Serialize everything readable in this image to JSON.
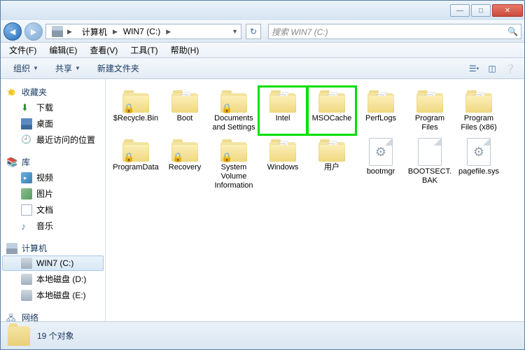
{
  "breadcrumb": {
    "seg1": "计算机",
    "seg2": "WIN7 (C:)"
  },
  "search": {
    "placeholder": "搜索 WIN7 (C:)"
  },
  "menu": {
    "file": "文件(F)",
    "edit": "编辑(E)",
    "view": "查看(V)",
    "tools": "工具(T)",
    "help": "帮助(H)"
  },
  "toolbar": {
    "organize": "组织",
    "share": "共享",
    "newfolder": "新建文件夹"
  },
  "sidebar": {
    "fav": "收藏夹",
    "download": "下载",
    "desktop": "桌面",
    "recent": "最近访问的位置",
    "lib": "库",
    "video": "视频",
    "pic": "图片",
    "doc": "文档",
    "music": "音乐",
    "computer": "计算机",
    "drive_c": "WIN7 (C:)",
    "drive_d": "本地磁盘 (D:)",
    "drive_e": "本地磁盘 (E:)",
    "network": "网络"
  },
  "items": {
    "recycle": "$Recycle.Bin",
    "boot": "Boot",
    "docs": "Documents and Settings",
    "intel": "Intel",
    "msocache": "MSOCache",
    "perflogs": "PerfLogs",
    "progfiles": "Program Files",
    "progfiles86": "Program Files (x86)",
    "programdata": "ProgramData",
    "recovery": "Recovery",
    "svi": "System Volume Information",
    "windows": "Windows",
    "users": "用户",
    "bootmgr": "bootmgr",
    "bootsect": "BOOTSECT.BAK",
    "pagefile": "pagefile.sys"
  },
  "status": {
    "count": "19 个对象"
  }
}
